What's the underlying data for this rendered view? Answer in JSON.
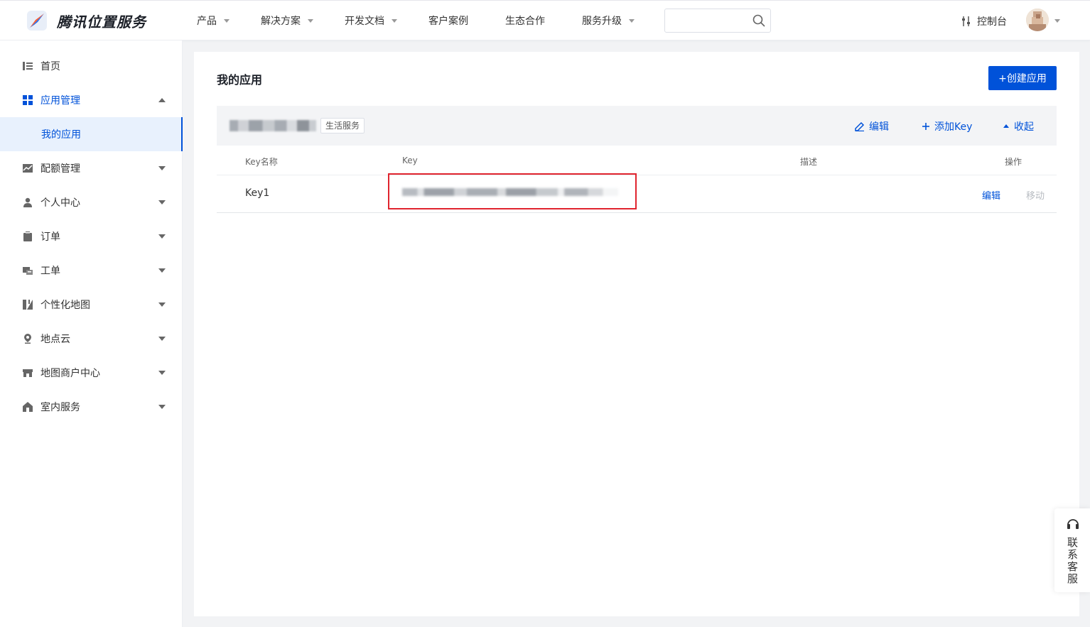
{
  "header": {
    "brand": "腾讯位置服务",
    "nav": [
      {
        "label": "产品",
        "has_dropdown": true
      },
      {
        "label": "解决方案",
        "has_dropdown": true
      },
      {
        "label": "开发文档",
        "has_dropdown": true
      },
      {
        "label": "客户案例",
        "has_dropdown": false
      },
      {
        "label": "生态合作",
        "has_dropdown": false
      },
      {
        "label": "服务升级",
        "has_dropdown": true
      }
    ],
    "search": {
      "value": "",
      "placeholder": ""
    },
    "console_label": "控制台"
  },
  "sidebar": {
    "items": [
      {
        "label": "首页",
        "icon": "list-icon"
      },
      {
        "label": "应用管理",
        "icon": "grid-icon",
        "expanded": true
      },
      {
        "label": "我的应用",
        "sub": true,
        "active": true
      },
      {
        "label": "配额管理",
        "icon": "chart-icon"
      },
      {
        "label": "个人中心",
        "icon": "user-icon"
      },
      {
        "label": "订单",
        "icon": "clipboard-icon"
      },
      {
        "label": "工单",
        "icon": "ticket-icon"
      },
      {
        "label": "个性化地图",
        "icon": "map-style-icon"
      },
      {
        "label": "地点云",
        "icon": "location-pin-icon"
      },
      {
        "label": "地图商户中心",
        "icon": "store-icon"
      },
      {
        "label": "室内服务",
        "icon": "home-icon"
      }
    ]
  },
  "main": {
    "title": "我的应用",
    "create_button": "+创建应用",
    "app": {
      "tag": "生活服务",
      "actions": {
        "edit": "编辑",
        "add_key": "添加Key",
        "collapse": "收起"
      }
    },
    "table": {
      "headers": [
        "Key名称",
        "Key",
        "描述",
        "操作"
      ],
      "rows": [
        {
          "name": "Key1",
          "description": "",
          "actions": {
            "edit": "编辑",
            "move": "移动"
          }
        }
      ]
    }
  },
  "contact": {
    "label": "联系客服"
  },
  "colors": {
    "accent": "#0052d9",
    "highlight_border": "#e0242e",
    "sidebar_active_bg": "#e8f1fd"
  }
}
